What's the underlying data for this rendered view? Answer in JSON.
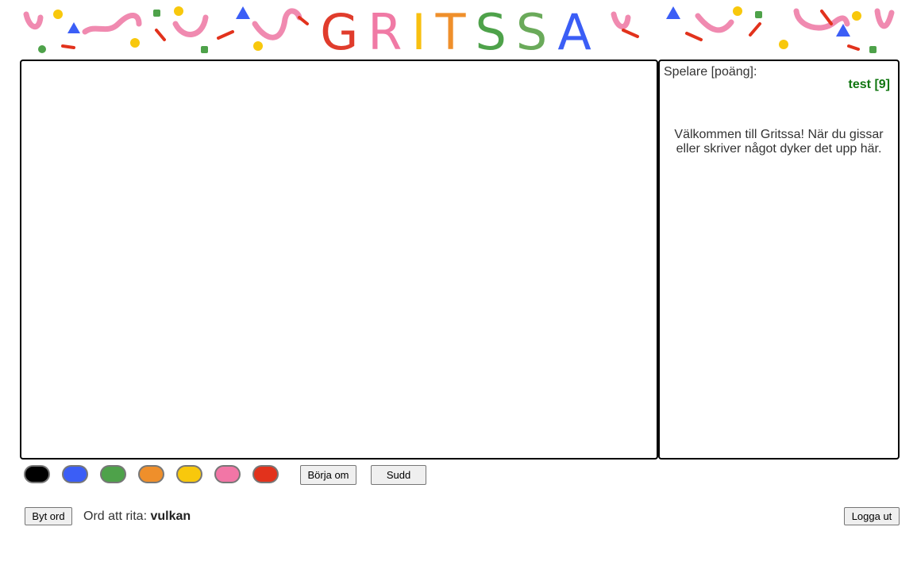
{
  "header": {
    "logo_text": "GRITSSA"
  },
  "players": {
    "label": "Spelare [poäng]:",
    "list": [
      {
        "entry": "test [9]"
      }
    ]
  },
  "chat": {
    "welcome": "Välkommen till Gritssa! När du gissar eller skriver något dyker det upp här."
  },
  "palette": {
    "colors": [
      {
        "name": "black",
        "hex": "#000000"
      },
      {
        "name": "blue",
        "hex": "#3b5ef6"
      },
      {
        "name": "green",
        "hex": "#4ea24a"
      },
      {
        "name": "orange",
        "hex": "#ef8f2b"
      },
      {
        "name": "yellow",
        "hex": "#f8c80c"
      },
      {
        "name": "pink",
        "hex": "#f276a6"
      },
      {
        "name": "red",
        "hex": "#e2321c"
      }
    ]
  },
  "controls": {
    "restart_label": "Börja om",
    "eraser_label": "Sudd"
  },
  "footer": {
    "change_word_label": "Byt ord",
    "word_prefix": "Ord att rita:",
    "word": "vulkan",
    "logout_label": "Logga ut"
  }
}
